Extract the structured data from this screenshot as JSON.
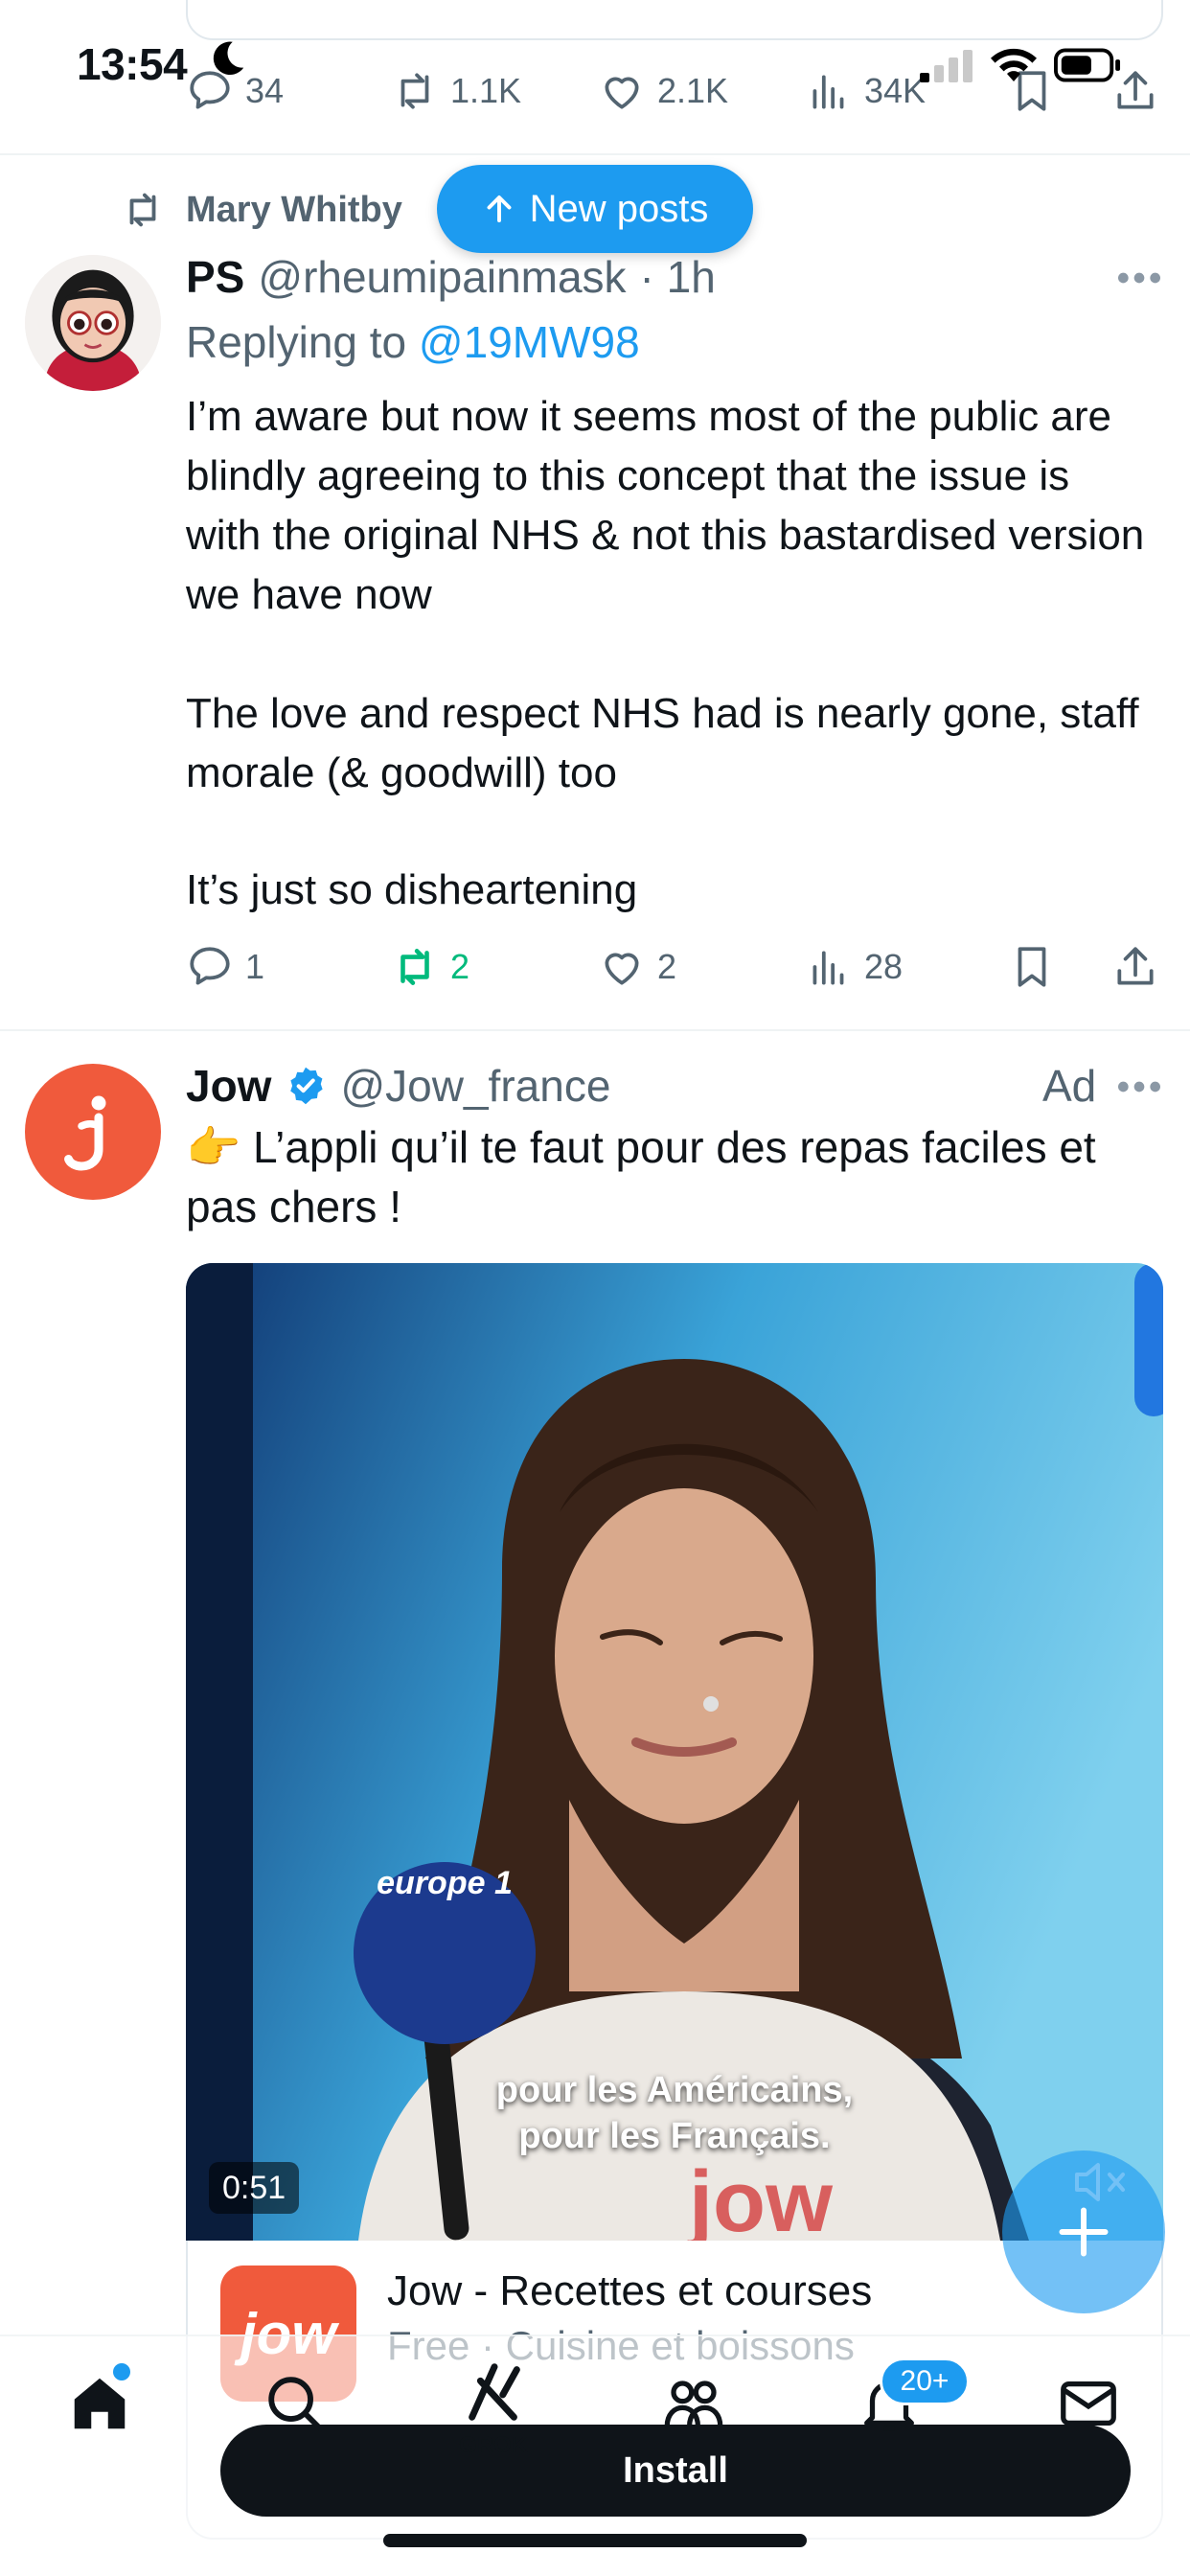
{
  "status_bar": {
    "time": "13:54"
  },
  "prev_post": {
    "replies": "34",
    "reposts": "1.1K",
    "likes": "2.1K",
    "views": "34K"
  },
  "new_posts_label": "New posts",
  "post1": {
    "reposted_by": "Mary Whitby",
    "name": "PS",
    "handle": "@rheumipainmask",
    "time": "· 1h",
    "replying_prefix": "Replying to",
    "replying_to": "@19MW98",
    "paragraphs": [
      "I’m aware but now it seems most of the public are blindly agreeing to this concept that the issue is with the original NHS & not this bastardised version we have now",
      "The love and respect NHS had is nearly gone, staff morale (& goodwill) too",
      "It’s just so disheartening"
    ],
    "replies": "1",
    "reposts": "2",
    "likes": "2",
    "views": "28"
  },
  "post2": {
    "name": "Jow",
    "handle": "@Jow_france",
    "ad_label": "Ad",
    "text": "👉 L’appli qu’il te faut pour des repas faciles et pas chers !",
    "video": {
      "mic_label": "europe 1",
      "subtitle_line1": "pour les Américains,",
      "subtitle_line2": "pour les Français.",
      "duration": "0:51"
    },
    "app": {
      "icon_text": "jow",
      "name": "Jow - Recettes et courses",
      "subtitle": "Free · Cuisine et boissons",
      "install_label": "Install"
    }
  },
  "nav": {
    "items": [
      "home-icon",
      "search-icon",
      "grok-icon",
      "communities-icon",
      "notifications-icon",
      "messages-icon"
    ],
    "grok_label": "GROK",
    "notifications_badge": "20+"
  },
  "colors": {
    "accent": "#1d9bf0",
    "repost_green": "#00ba7c",
    "brand_jow": "#f05a3c"
  }
}
